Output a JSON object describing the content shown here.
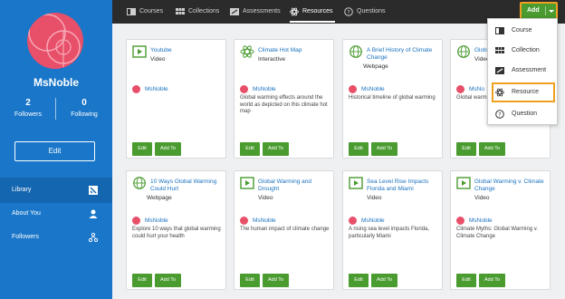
{
  "profile": {
    "name": "MsNoble",
    "followers_count": "2",
    "followers_label": "Followers",
    "following_count": "0",
    "following_label": "Following",
    "edit_label": "Edit"
  },
  "sidebar": {
    "items": [
      {
        "label": "Library",
        "icon": "library-icon",
        "active": true
      },
      {
        "label": "About You",
        "icon": "person-icon",
        "active": false
      },
      {
        "label": "Followers",
        "icon": "network-icon",
        "active": false
      }
    ]
  },
  "tabs": [
    {
      "label": "Courses",
      "icon": "courses-icon"
    },
    {
      "label": "Collections",
      "icon": "collections-icon"
    },
    {
      "label": "Assessments",
      "icon": "assessments-icon"
    },
    {
      "label": "Resources",
      "icon": "atom-icon",
      "active": true
    },
    {
      "label": "Questions",
      "icon": "question-icon"
    }
  ],
  "add_button": {
    "label": "Add"
  },
  "dropdown": {
    "items": [
      {
        "label": "Course",
        "icon": "courses-icon"
      },
      {
        "label": "Collection",
        "icon": "collections-icon"
      },
      {
        "label": "Assessment",
        "icon": "assessments-icon"
      },
      {
        "label": "Resource",
        "icon": "atom-icon",
        "highlighted": true
      },
      {
        "label": "Question",
        "icon": "question-icon"
      }
    ]
  },
  "cards": [
    {
      "title": "Youtube",
      "type": "Video",
      "icon": "video-icon",
      "owner": "MsNoble",
      "desc": "",
      "edit": "Edit",
      "add": "Add To"
    },
    {
      "title": "Climate Hot Map",
      "type": "Interactive",
      "icon": "atom-icon",
      "owner": "MsNoble",
      "desc": "Global warming effects around the world as depicted on this climate hot map",
      "edit": "Edit",
      "add": "Add To"
    },
    {
      "title": "A Brief History of Climate Change",
      "type": "Webpage",
      "icon": "globe-icon",
      "owner": "MsNoble",
      "desc": "Historical timeline of global warming",
      "edit": "Edit",
      "add": "Add To"
    },
    {
      "title": "Glob",
      "type": "Video",
      "icon": "globe-icon",
      "owner": "MsNo",
      "desc": "Global warm century and",
      "edit": "Edit",
      "add": "Add To"
    },
    {
      "title": "10 Ways Global Warming Could Hurt",
      "type": "Webpage",
      "icon": "globe-icon",
      "owner": "MsNoble",
      "desc": "Explore 10 ways that global warming could hurt your health",
      "edit": "Edit",
      "add": "Add To"
    },
    {
      "title": "Global Warming and Drought",
      "type": "Video",
      "icon": "video-icon",
      "owner": "MsNoble",
      "desc": "The human impact of climate change",
      "edit": "Edit",
      "add": "Add To"
    },
    {
      "title": "Sea Level Rise Impacts Florida and Miami",
      "type": "Video",
      "icon": "video-icon",
      "owner": "MsNoble",
      "desc": "A rising sea level impacts Florida, particularly Miami",
      "edit": "Edit",
      "add": "Add To"
    },
    {
      "title": "Global Warming v. Climate Change",
      "type": "Video",
      "icon": "video-icon",
      "owner": "MsNoble",
      "desc": "Climate Myths: Global Warming v. Climate Change",
      "edit": "Edit",
      "add": "Add To"
    }
  ],
  "colors": {
    "sidebar": "#1976c8",
    "topbar": "#2b2b2b",
    "accent_green": "#4a9b30",
    "highlight_orange": "#f0a020",
    "avatar_pink": "#e8506a",
    "link_blue": "#1b72c0"
  }
}
